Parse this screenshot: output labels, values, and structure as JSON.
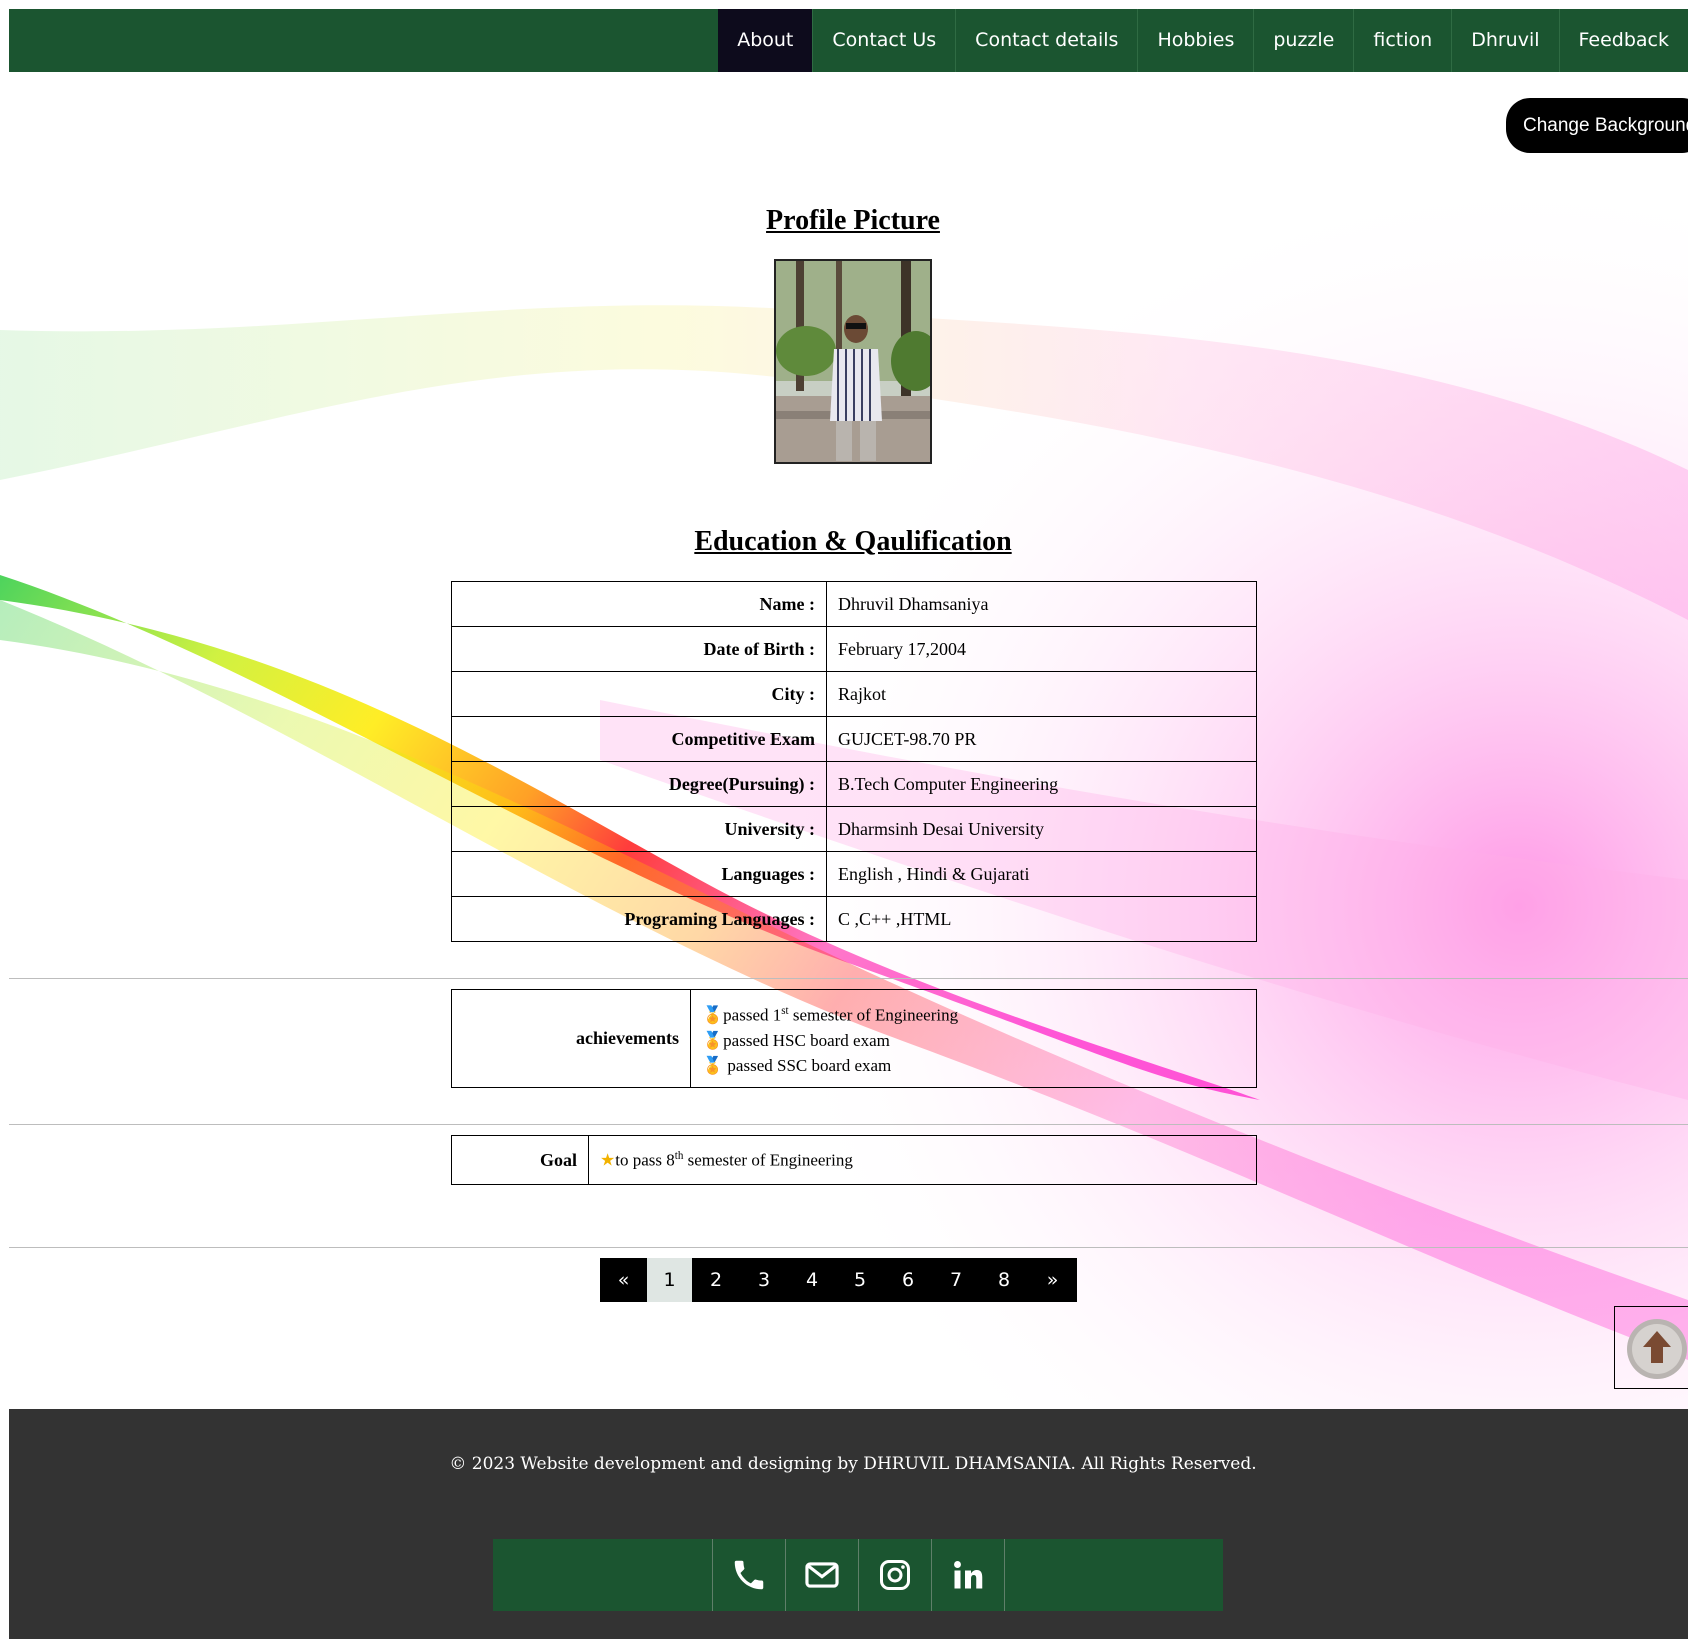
{
  "nav": {
    "items": [
      {
        "label": "About",
        "active": true
      },
      {
        "label": "Contact Us"
      },
      {
        "label": "Contact details"
      },
      {
        "label": "Hobbies"
      },
      {
        "label": "puzzle"
      },
      {
        "label": "fiction"
      },
      {
        "label": "Dhruvil"
      },
      {
        "label": "Feedback"
      }
    ]
  },
  "change_bg_label": "Change Background",
  "profile": {
    "title": "Profile Picture"
  },
  "education": {
    "title": "Education & Qaulification",
    "rows": [
      {
        "key": "Name :",
        "value": "Dhruvil Dhamsaniya"
      },
      {
        "key": "Date of Birth :",
        "value": "February 17,2004"
      },
      {
        "key": "City :",
        "value": "Rajkot"
      },
      {
        "key": "Competitive Exam",
        "value": "GUJCET-98.70 PR"
      },
      {
        "key": "Degree(Pursuing) :",
        "value": "B.Tech Computer Engineering"
      },
      {
        "key": "University :",
        "value": "Dharmsinh Desai University"
      },
      {
        "key": "Languages :",
        "value": "English , Hindi & Gujarati"
      },
      {
        "key": "Programing Languages :",
        "value": "C ,C++ ,HTML"
      }
    ]
  },
  "achievements": {
    "label": "achievements",
    "items": [
      {
        "pre": "passed 1",
        "sup": "st",
        "post": " semester of Engineering"
      },
      {
        "pre": "passed HSC board exam",
        "sup": "",
        "post": ""
      },
      {
        "pre": " passed SSC board exam",
        "sup": "",
        "post": ""
      }
    ]
  },
  "goal": {
    "label": "Goal",
    "pre": "to pass 8",
    "sup": "th",
    "post": " semester of Engineering"
  },
  "pagination": {
    "prev": "«",
    "pages": [
      "1",
      "2",
      "3",
      "4",
      "5",
      "6",
      "7",
      "8"
    ],
    "current": "1",
    "next": "»"
  },
  "footer": {
    "copyright": "© 2023 Website development and designing by DHRUVIL DHAMSANIA. All Rights Reserved.",
    "social": [
      "phone-icon",
      "mail-icon",
      "instagram-icon",
      "linkedin-icon"
    ]
  },
  "colors": {
    "nav_bg": "#1b5530",
    "nav_active": "#0d0b1c",
    "footer_bg": "#333333"
  }
}
